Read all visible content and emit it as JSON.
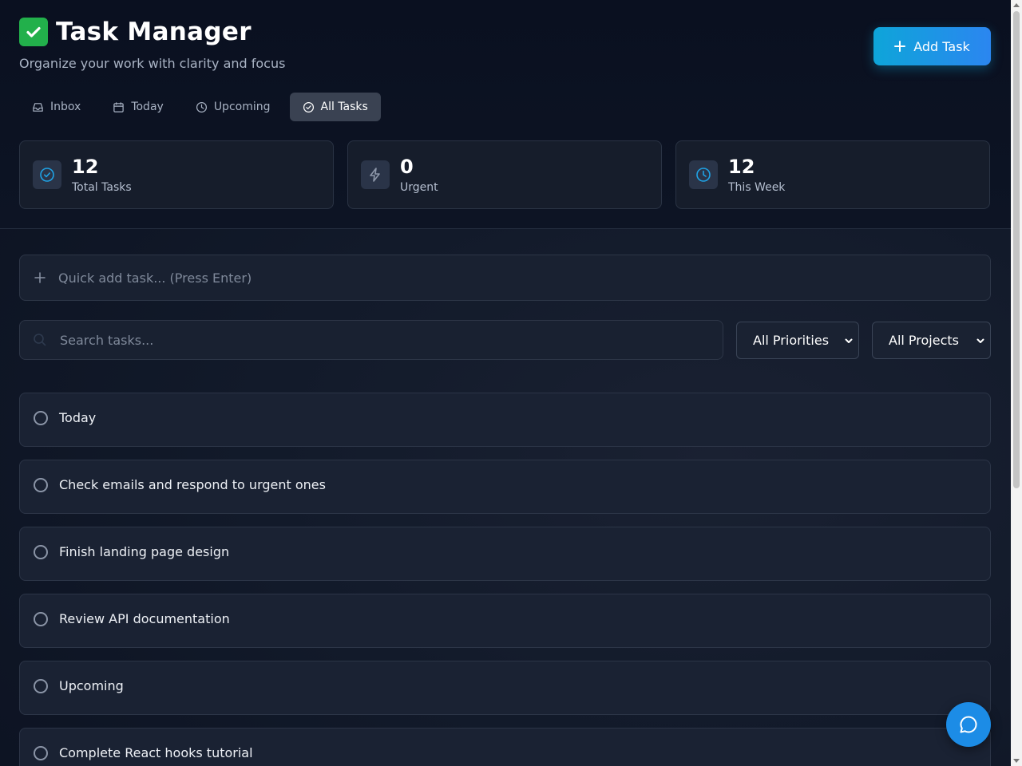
{
  "header": {
    "title": "Task Manager",
    "subtitle": "Organize your work with clarity and focus",
    "add_task_label": "Add Task"
  },
  "tabs": [
    {
      "label": "Inbox",
      "icon": "inbox-icon",
      "active": false
    },
    {
      "label": "Today",
      "icon": "calendar-icon",
      "active": false
    },
    {
      "label": "Upcoming",
      "icon": "clock-icon",
      "active": false
    },
    {
      "label": "All Tasks",
      "icon": "check-circle-icon",
      "active": true
    }
  ],
  "stats": [
    {
      "value": "12",
      "label": "Total Tasks",
      "icon": "check-circle-icon",
      "color": "#1fa3e6"
    },
    {
      "value": "0",
      "label": "Urgent",
      "icon": "lightning-icon",
      "color": "#8e98aa"
    },
    {
      "value": "12",
      "label": "This Week",
      "icon": "clock-icon",
      "color": "#1fa3e6"
    }
  ],
  "quick_add": {
    "placeholder": "Quick add task... (Press Enter)"
  },
  "search": {
    "placeholder": "Search tasks..."
  },
  "filters": {
    "priority_selected": "All Priorities",
    "project_selected": "All Projects"
  },
  "tasks": [
    {
      "title": "Today"
    },
    {
      "title": "Check emails and respond to urgent ones"
    },
    {
      "title": "Finish landing page design"
    },
    {
      "title": "Review API documentation"
    },
    {
      "title": "Upcoming"
    },
    {
      "title": "Complete React hooks tutorial"
    }
  ],
  "colors": {
    "accent": "#0ea5d9",
    "accent_end": "#2b86f0",
    "fab": "#1c8ce6",
    "background": "#0c1220"
  }
}
